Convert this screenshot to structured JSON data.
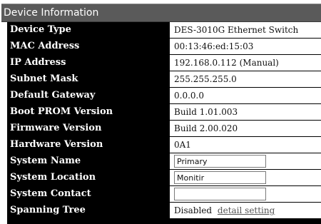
{
  "panel": {
    "title": "Device Information"
  },
  "rows": {
    "device_type": {
      "label": "Device Type",
      "value": "DES-3010G Ethernet Switch"
    },
    "mac_address": {
      "label": "MAC Address",
      "value": "00:13:46:ed:15:03"
    },
    "ip_address": {
      "label": "IP Address",
      "value": "192.168.0.112 (Manual)"
    },
    "subnet_mask": {
      "label": "Subnet Mask",
      "value": "255.255.255.0"
    },
    "default_gateway": {
      "label": "Default Gateway",
      "value": "0.0.0.0"
    },
    "boot_prom_version": {
      "label": "Boot PROM Version",
      "value": "Build 1.01.003"
    },
    "firmware_version": {
      "label": "Firmware Version",
      "value": "Build 2.00.020"
    },
    "hardware_version": {
      "label": "Hardware Version",
      "value": "0A1"
    },
    "system_name": {
      "label": "System Name",
      "value": "Primary"
    },
    "system_location": {
      "label": "System Location",
      "value": "Monitir"
    },
    "system_contact": {
      "label": "System Contact",
      "value": ""
    },
    "spanning_tree": {
      "label": "Spanning Tree",
      "value": "Disabled",
      "link": "detail setting"
    }
  }
}
